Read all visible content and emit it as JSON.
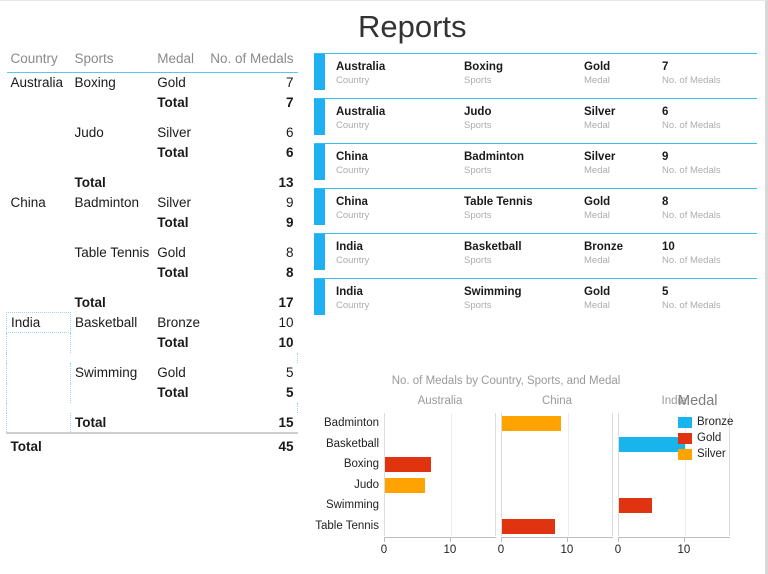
{
  "header": {
    "title": "Reports"
  },
  "pivot": {
    "columns": [
      "Country",
      "Sports",
      "Medal",
      "No. of Medals"
    ],
    "rows": [
      {
        "country": "Australia",
        "sport": "Boxing",
        "medal": "Gold",
        "count": "7"
      },
      {
        "country": "",
        "sport": "",
        "medal": "Total",
        "count": "7",
        "bold": true
      },
      {
        "country": "",
        "sport": "Judo",
        "medal": "Silver",
        "count": "6"
      },
      {
        "country": "",
        "sport": "",
        "medal": "Total",
        "count": "6",
        "bold": true
      },
      {
        "country": "",
        "sport": "Total",
        "medal": "",
        "count": "13",
        "bold": true
      },
      {
        "country": "China",
        "sport": "Badminton",
        "medal": "Silver",
        "count": "9"
      },
      {
        "country": "",
        "sport": "",
        "medal": "Total",
        "count": "9",
        "bold": true
      },
      {
        "country": "",
        "sport": "Table Tennis",
        "medal": "Gold",
        "count": "8"
      },
      {
        "country": "",
        "sport": "",
        "medal": "Total",
        "count": "8",
        "bold": true
      },
      {
        "country": "",
        "sport": "Total",
        "medal": "",
        "count": "17",
        "bold": true
      },
      {
        "country": "India",
        "sport": "Basketball",
        "medal": "Bronze",
        "count": "10"
      },
      {
        "country": "",
        "sport": "",
        "medal": "Total",
        "count": "10",
        "bold": true
      },
      {
        "country": "",
        "sport": "Swimming",
        "medal": "Gold",
        "count": "5"
      },
      {
        "country": "",
        "sport": "",
        "medal": "Total",
        "count": "5",
        "bold": true
      },
      {
        "country": "",
        "sport": "Total",
        "medal": "",
        "count": "15",
        "bold": true
      }
    ],
    "grand_total": {
      "label": "Total",
      "count": "45"
    }
  },
  "cards": {
    "field_labels": {
      "country": "Country",
      "sports": "Sports",
      "medal": "Medal",
      "count": "No. of Medals"
    },
    "accent_color": "#1eb0f0",
    "items": [
      {
        "country": "Australia",
        "sports": "Boxing",
        "medal": "Gold",
        "count": "7"
      },
      {
        "country": "Australia",
        "sports": "Judo",
        "medal": "Silver",
        "count": "6"
      },
      {
        "country": "China",
        "sports": "Badminton",
        "medal": "Silver",
        "count": "9"
      },
      {
        "country": "China",
        "sports": "Table Tennis",
        "medal": "Gold",
        "count": "8"
      },
      {
        "country": "India",
        "sports": "Basketball",
        "medal": "Bronze",
        "count": "10"
      },
      {
        "country": "India",
        "sports": "Swimming",
        "medal": "Gold",
        "count": "5"
      }
    ]
  },
  "chart_data": {
    "type": "bar",
    "orientation": "horizontal",
    "title": "No. of Medals by Country, Sports, and Medal",
    "xlabel": "",
    "ylabel": "",
    "xlim": [
      0,
      17
    ],
    "xticks": [
      0,
      10
    ],
    "grid": true,
    "legend": {
      "title": "Medal",
      "position": "right",
      "entries": [
        {
          "name": "Bronze",
          "color": "#1ab4ec"
        },
        {
          "name": "Gold",
          "color": "#e03411"
        },
        {
          "name": "Silver",
          "color": "#ffa300"
        }
      ]
    },
    "panels": [
      "Australia",
      "China",
      "India"
    ],
    "categories": [
      "Badminton",
      "Basketball",
      "Boxing",
      "Judo",
      "Swimming",
      "Table Tennis"
    ],
    "bars": [
      {
        "panel": "Australia",
        "category": "Boxing",
        "medal": "Gold",
        "value": 7,
        "color": "#e03411"
      },
      {
        "panel": "Australia",
        "category": "Judo",
        "medal": "Silver",
        "value": 6,
        "color": "#ffa300"
      },
      {
        "panel": "China",
        "category": "Badminton",
        "medal": "Silver",
        "value": 9,
        "color": "#ffa300"
      },
      {
        "panel": "China",
        "category": "Table Tennis",
        "medal": "Gold",
        "value": 8,
        "color": "#e03411"
      },
      {
        "panel": "India",
        "category": "Basketball",
        "medal": "Bronze",
        "value": 10,
        "color": "#1ab4ec"
      },
      {
        "panel": "India",
        "category": "Swimming",
        "medal": "Gold",
        "value": 5,
        "color": "#e03411"
      }
    ]
  }
}
